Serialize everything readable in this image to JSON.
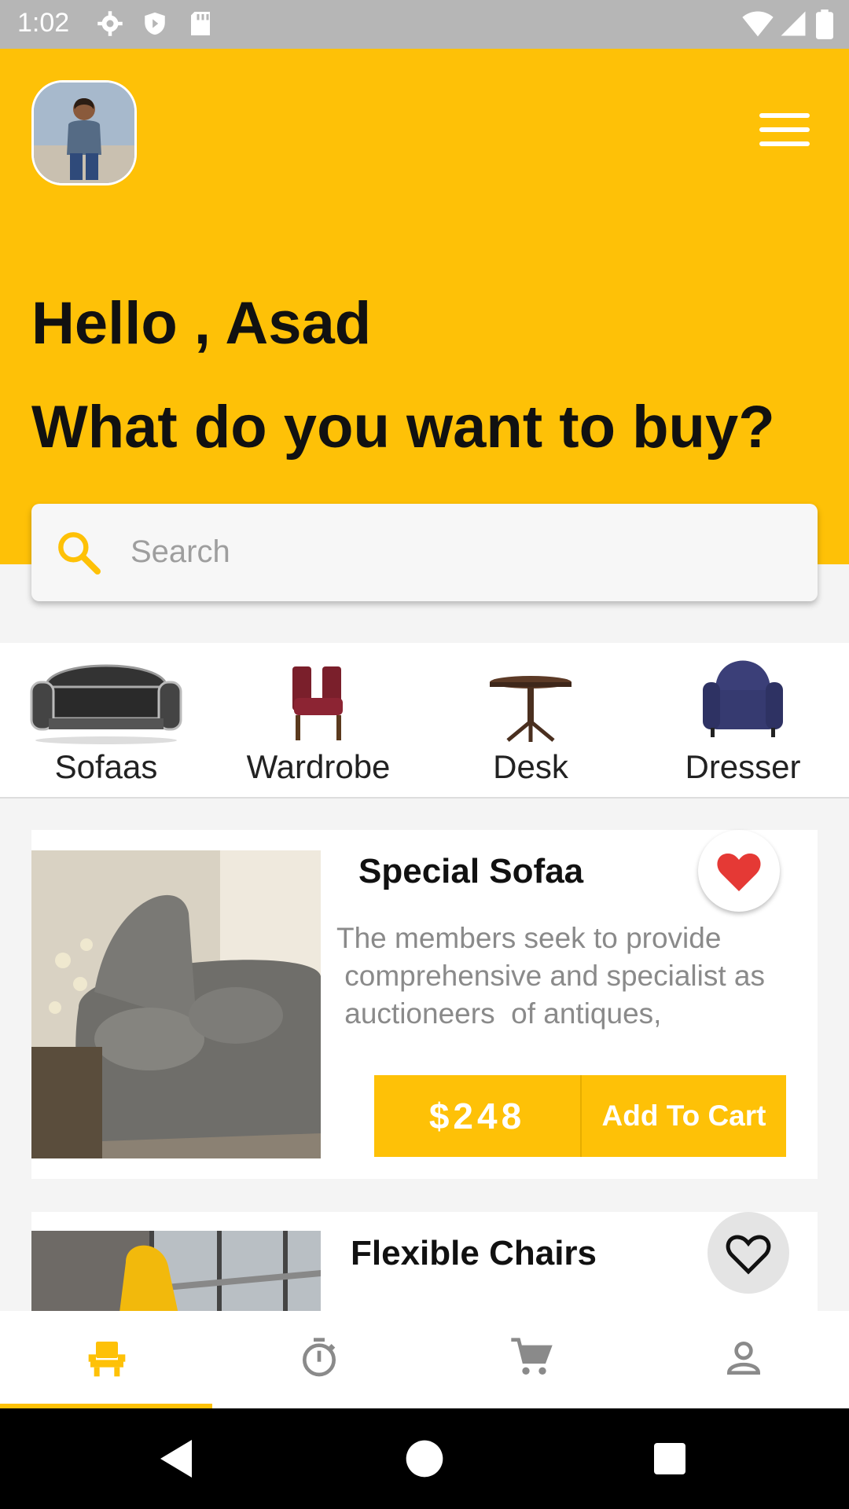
{
  "status_bar": {
    "time": "1:02",
    "icons": [
      "gear-icon",
      "shield-icon",
      "sd-card-icon",
      "wifi-icon",
      "signal-icon",
      "battery-icon"
    ]
  },
  "header": {
    "greeting": "Hello , Asad",
    "question": "What do you want to buy?",
    "accent_color": "#fec107"
  },
  "search": {
    "placeholder": "Search"
  },
  "categories": [
    {
      "label": "Sofaas",
      "icon": "sofa-icon"
    },
    {
      "label": "Wardrobe",
      "icon": "chair-icon"
    },
    {
      "label": "Desk",
      "icon": "table-icon"
    },
    {
      "label": "Dresser",
      "icon": "armchair-icon"
    }
  ],
  "products": [
    {
      "title": "Special Sofaa",
      "description_lines": [
        "The members seek to provide",
        " comprehensive and specialist as",
        " auctioneers  of antiques,"
      ],
      "price": "$248",
      "cart_label": "Add To Cart",
      "favorited": true
    },
    {
      "title": "Flexible Chairs",
      "favorited": false
    }
  ],
  "bottom_nav": {
    "items": [
      "chair-nav-icon",
      "timer-icon",
      "cart-icon",
      "profile-icon"
    ],
    "active_index": 0
  }
}
